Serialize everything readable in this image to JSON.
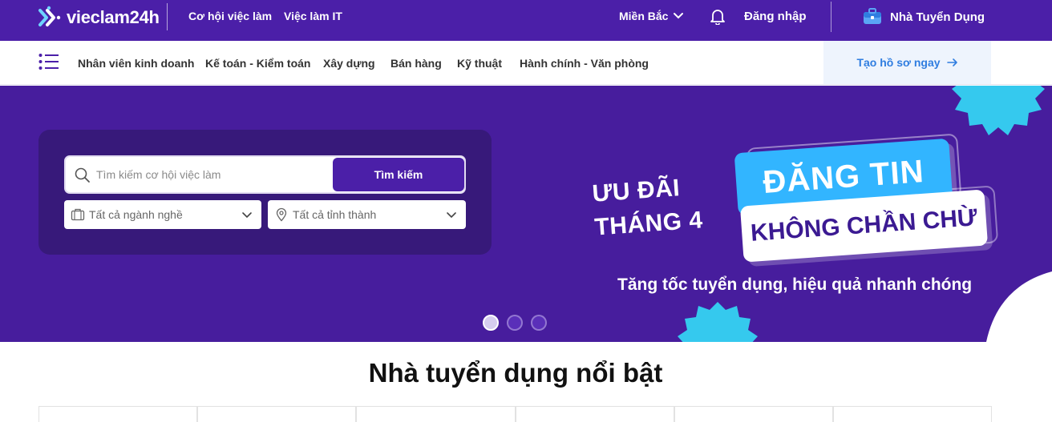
{
  "header": {
    "logo_text": "vieclam24h",
    "nav": [
      "Cơ hội việc làm",
      "Việc làm IT"
    ],
    "region": "Miền Bắc",
    "login_label": "Đăng nhập",
    "employer_label": "Nhà Tuyển Dụng"
  },
  "categories": {
    "items": [
      "Nhân viên kinh doanh",
      "Kế toán - Kiểm toán",
      "Xây dựng",
      "Bán hàng",
      "Kỹ thuật",
      "Hành chính - Văn phòng"
    ],
    "cta_label": "Tạo hồ sơ ngay"
  },
  "search": {
    "placeholder": "Tìm kiếm cơ hội việc làm",
    "value": "",
    "button_label": "Tìm kiếm",
    "industry_select": "Tất cả ngành nghề",
    "location_select": "Tất cả tỉnh thành"
  },
  "banner": {
    "line1": "ƯU ĐÃI",
    "line2": "THÁNG 4",
    "highlight1": "ĐĂNG TIN",
    "highlight2": "KHÔNG CHẦN CHỪ",
    "tagline": "Tăng tốc tuyển dụng, hiệu quả nhanh chóng",
    "slides_total": 3,
    "active_slide": 1
  },
  "featured": {
    "title": "Nhà tuyển dụng nổi bật"
  },
  "colors": {
    "brand": "#4b1fa8",
    "panel": "#37197a",
    "accent_blue": "#32b5ff",
    "cta_text": "#2f7de0"
  }
}
